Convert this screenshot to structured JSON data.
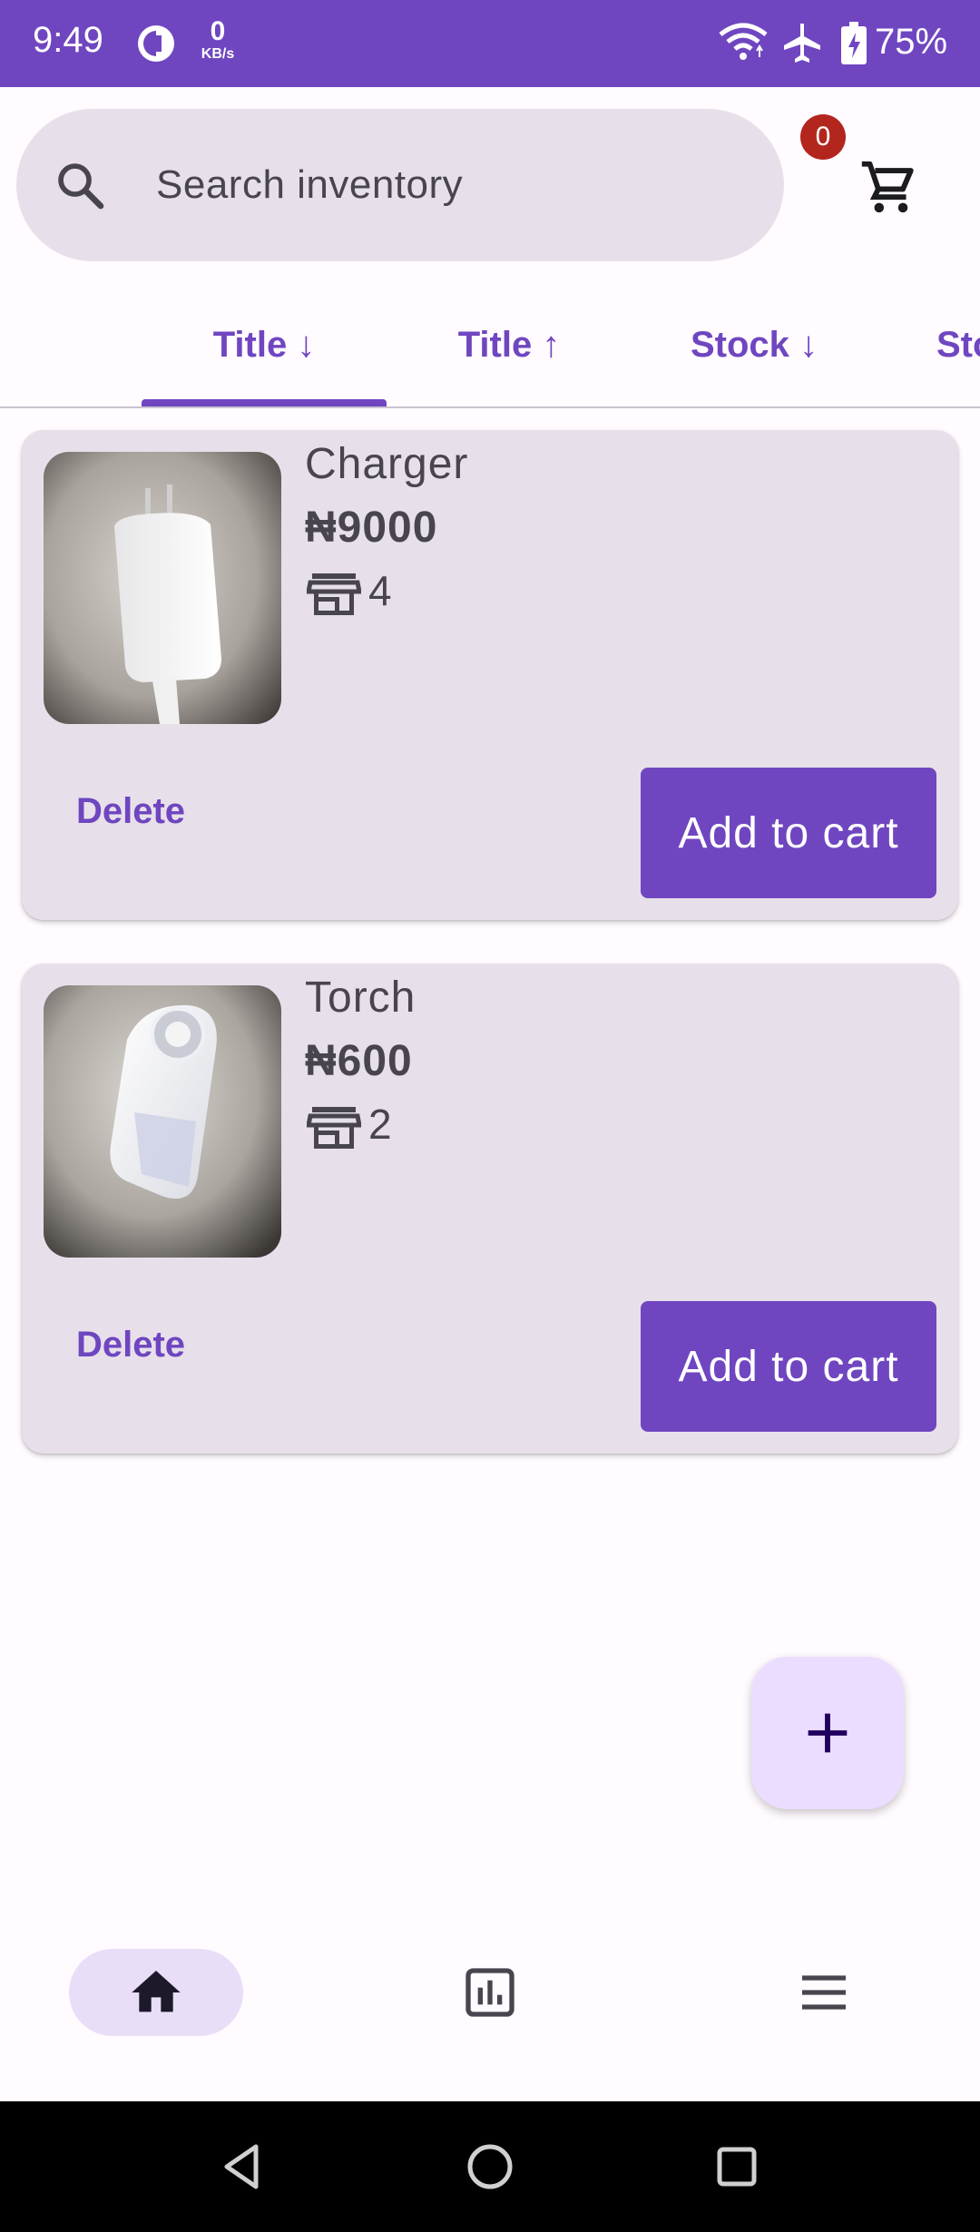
{
  "status_bar": {
    "time": "9:49",
    "net_speed": "0",
    "net_speed_unit": "KB/s",
    "battery": "75%"
  },
  "search": {
    "placeholder": "Search inventory",
    "value": "",
    "icon": "search-icon"
  },
  "cart": {
    "count": "0",
    "icon": "cart-icon"
  },
  "sort_tabs": [
    {
      "label": "Title ↓",
      "active": true
    },
    {
      "label": "Title ↑",
      "active": false
    },
    {
      "label": "Stock ↓",
      "active": false
    },
    {
      "label": "Stock ↑",
      "active": false
    }
  ],
  "products": [
    {
      "title": "Charger",
      "price": "₦9000",
      "stock": "4",
      "stock_icon": "store-icon",
      "image": "charger-photo",
      "delete_label": "Delete",
      "add_label": "Add to cart"
    },
    {
      "title": "Torch",
      "price": "₦600",
      "stock": "2",
      "stock_icon": "store-icon",
      "image": "torch-photo",
      "delete_label": "Delete",
      "add_label": "Add to cart"
    }
  ],
  "fab": {
    "icon": "plus-icon"
  },
  "bottom_nav": [
    {
      "icon": "home-icon",
      "active": true
    },
    {
      "icon": "bar-chart-icon",
      "active": false
    },
    {
      "icon": "menu-icon",
      "active": false
    }
  ],
  "system_nav": [
    "back-icon",
    "home-circle-icon",
    "recents-icon"
  ],
  "colors": {
    "primary": "#6f46c0",
    "surface_variant": "#e7e0ea",
    "badge": "#b3261e",
    "fab_container": "#eaddff",
    "nav_indicator": "#e8def8"
  }
}
